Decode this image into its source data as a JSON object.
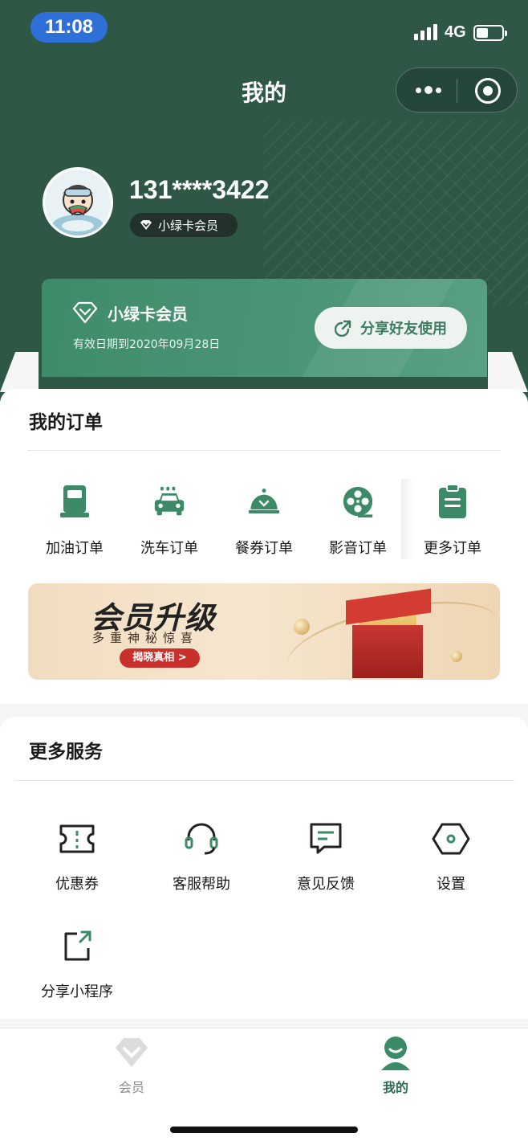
{
  "status_bar": {
    "time": "11:08",
    "network": "4G"
  },
  "header": {
    "title": "我的"
  },
  "profile": {
    "phone": "131****3422",
    "member_tag": "小绿卡会员"
  },
  "member_card": {
    "name": "小绿卡会员",
    "valid_until": "有效日期到2020年09月28日",
    "share_label": "分享好友使用"
  },
  "orders": {
    "title": "我的订单",
    "items": [
      {
        "label": "加油订单",
        "icon": "fuel-pump-icon"
      },
      {
        "label": "洗车订单",
        "icon": "car-wash-icon"
      },
      {
        "label": "餐券订单",
        "icon": "food-cloche-icon"
      },
      {
        "label": "影音订单",
        "icon": "film-reel-icon"
      },
      {
        "label": "更多订单",
        "icon": "clipboard-icon"
      }
    ]
  },
  "banner": {
    "title": "会员升级",
    "subtitle": "多重神秘惊喜",
    "cta": "揭晓真相 >"
  },
  "services": {
    "title": "更多服务",
    "items": [
      {
        "label": "优惠券",
        "icon": "coupon-icon"
      },
      {
        "label": "客服帮助",
        "icon": "headset-icon"
      },
      {
        "label": "意见反馈",
        "icon": "feedback-icon"
      },
      {
        "label": "设置",
        "icon": "settings-icon"
      },
      {
        "label": "分享小程序",
        "icon": "share-icon"
      }
    ]
  },
  "tabbar": {
    "items": [
      {
        "label": "会员",
        "icon": "diamond-icon",
        "active": false
      },
      {
        "label": "我的",
        "icon": "user-icon",
        "active": true
      }
    ]
  },
  "colors": {
    "brand": "#2e5746",
    "accent": "#3c8a67",
    "inactive": "#8a8a8a",
    "promo_red": "#c9302c"
  }
}
